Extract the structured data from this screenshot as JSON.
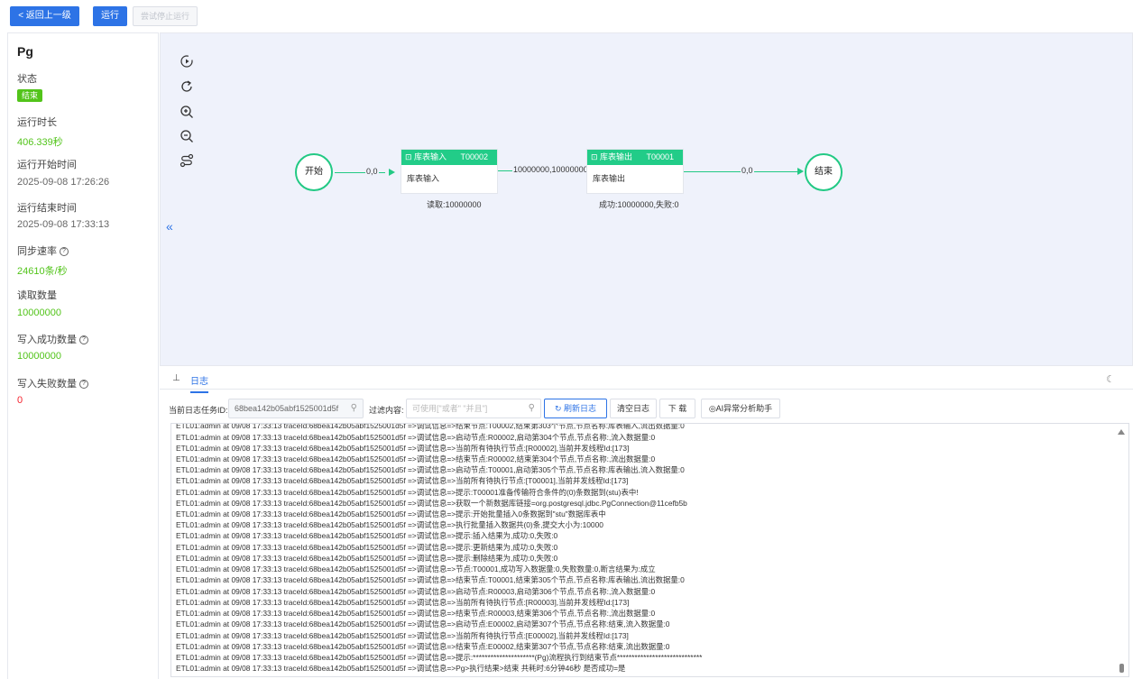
{
  "toolbar": {
    "back_label": "< 返回上一级",
    "run_label": "运行",
    "stop_label": "尝试停止运行"
  },
  "summary": {
    "title": "Pg",
    "status_label": "状态",
    "status_value": "结束",
    "duration_label": "运行时长",
    "duration_value": "406.339秒",
    "start_label": "运行开始时间",
    "start_value": "2025-09-08 17:26:26",
    "end_label": "运行结束时间",
    "end_value": "2025-09-08 17:33:13",
    "rate_label": "同步速率",
    "rate_value": "24610条/秒",
    "read_label": "读取数量",
    "read_value": "10000000",
    "write_ok_label": "写入成功数量",
    "write_ok_value": "10000000",
    "write_fail_label": "写入失败数量",
    "write_fail_value": "0"
  },
  "canvas": {
    "collapse_label": "«",
    "tools": [
      "replay-icon",
      "refresh-icon",
      "zoom-in-icon",
      "zoom-out-icon",
      "route-icon"
    ],
    "start_node": "开始",
    "end_node": "结束",
    "node1": {
      "title": "库表输入",
      "code": "T00002",
      "body": "库表输入",
      "stat": "读取:10000000"
    },
    "node2": {
      "title": "库表输出",
      "code": "T00001",
      "body": "库表输出",
      "stat": "成功:10000000,失败:0"
    },
    "edge1_label": "0,0",
    "edge2_label": "10000000,10000000",
    "edge3_label": "0,0"
  },
  "log": {
    "tab_label": "日志",
    "task_id_label": "当前日志任务ID:",
    "task_id_value": "68bea142b05abf1525001d5f",
    "filter_label": "过滤内容:",
    "filter_placeholder": "可使用[\"或者\" \"并且\"]",
    "refresh_label": "刷新日志",
    "clear_label": "清空日志",
    "download_label": "下 载",
    "ai_label": "AI异常分析助手",
    "lines": [
      "ETL01:admin at 09/08 17:33:13 traceId:68bea142b05abf1525001d5f =>调试信息=>结束节点:T00002,结束第303个节点,节点名称:库表输入,流出数据量:0",
      "ETL01:admin at 09/08 17:33:13 traceId:68bea142b05abf1525001d5f =>调试信息=>启动节点:R00002,启动第304个节点,节点名称:,流入数据量:0",
      "ETL01:admin at 09/08 17:33:13 traceId:68bea142b05abf1525001d5f =>调试信息=>当前所有待执行节点:[R00002],当前并发线程Id:[173]",
      "ETL01:admin at 09/08 17:33:13 traceId:68bea142b05abf1525001d5f =>调试信息=>结束节点:R00002,结束第304个节点,节点名称:,流出数据量:0",
      "ETL01:admin at 09/08 17:33:13 traceId:68bea142b05abf1525001d5f =>调试信息=>启动节点:T00001,启动第305个节点,节点名称:库表输出,流入数据量:0",
      "ETL01:admin at 09/08 17:33:13 traceId:68bea142b05abf1525001d5f =>调试信息=>当前所有待执行节点:[T00001],当前并发线程Id:[173]",
      "ETL01:admin at 09/08 17:33:13 traceId:68bea142b05abf1525001d5f =>调试信息=>提示:T00001准备传输符合条件的(0)条数据到(stu)表中!",
      "ETL01:admin at 09/08 17:33:13 traceId:68bea142b05abf1525001d5f =>调试信息=>获取一个新数据库链接=org.postgresql.jdbc.PgConnection@11cefb5b",
      "ETL01:admin at 09/08 17:33:13 traceId:68bea142b05abf1525001d5f =>调试信息=>提示:开始批量插入0条数据到\"stu\"数据库表中",
      "ETL01:admin at 09/08 17:33:13 traceId:68bea142b05abf1525001d5f =>调试信息=>执行批量插入数据共(0)条,提交大小为:10000",
      "ETL01:admin at 09/08 17:33:13 traceId:68bea142b05abf1525001d5f =>调试信息=>提示:插入结果为,成功:0,失败:0",
      "ETL01:admin at 09/08 17:33:13 traceId:68bea142b05abf1525001d5f =>调试信息=>提示:更新结果为,成功:0,失败:0",
      "ETL01:admin at 09/08 17:33:13 traceId:68bea142b05abf1525001d5f =>调试信息=>提示:删除结果为,成功:0,失败:0",
      "ETL01:admin at 09/08 17:33:13 traceId:68bea142b05abf1525001d5f =>调试信息=>节点:T00001,成功写入数据量:0,失败数量:0,断言结果为:成立",
      "ETL01:admin at 09/08 17:33:13 traceId:68bea142b05abf1525001d5f =>调试信息=>结束节点:T00001,结束第305个节点,节点名称:库表输出,流出数据量:0",
      "ETL01:admin at 09/08 17:33:13 traceId:68bea142b05abf1525001d5f =>调试信息=>启动节点:R00003,启动第306个节点,节点名称:,流入数据量:0",
      "ETL01:admin at 09/08 17:33:13 traceId:68bea142b05abf1525001d5f =>调试信息=>当前所有待执行节点:[R00003],当前并发线程Id:[173]",
      "ETL01:admin at 09/08 17:33:13 traceId:68bea142b05abf1525001d5f =>调试信息=>结束节点:R00003,结束第306个节点,节点名称:,流出数据量:0",
      "ETL01:admin at 09/08 17:33:13 traceId:68bea142b05abf1525001d5f =>调试信息=>启动节点:E00002,启动第307个节点,节点名称:结束,流入数据量:0",
      "ETL01:admin at 09/08 17:33:13 traceId:68bea142b05abf1525001d5f =>调试信息=>当前所有待执行节点:[E00002],当前并发线程Id:[173]",
      "ETL01:admin at 09/08 17:33:13 traceId:68bea142b05abf1525001d5f =>调试信息=>结束节点:E00002,结束第307个节点,节点名称:结束,流出数据量:0",
      "ETL01:admin at 09/08 17:33:13 traceId:68bea142b05abf1525001d5f =>调试信息=>提示:*********************(Pg)流程执行到结束节点*****************************",
      "ETL01:admin at 09/08 17:33:13 traceId:68bea142b05abf1525001d5f =>调试信息=>Pg>执行结果>结束 共耗时:6分钟46秒 是否成功=是"
    ]
  }
}
